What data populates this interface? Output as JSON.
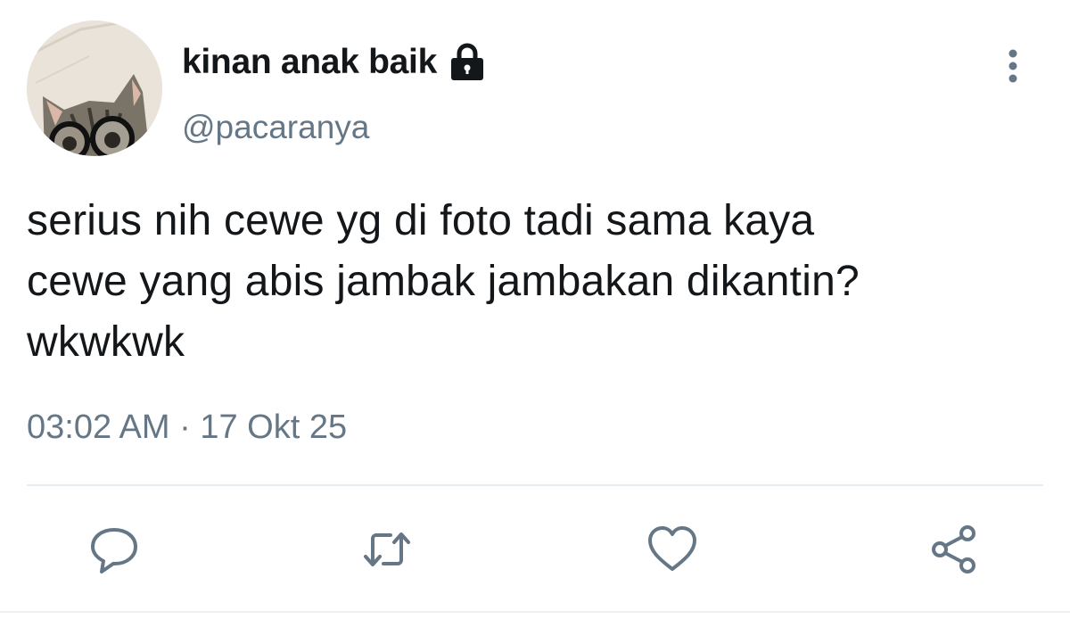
{
  "user": {
    "display_name": "kinan anak baik",
    "handle": "@pacaranya",
    "avatar": "cat-with-glasses-avatar",
    "protected_icon": "lock-icon"
  },
  "tweet": {
    "text": "serius nih cewe yg di foto tadi sama kaya\ncewe yang abis jambak jambakan dikantin?\nwkwkwk",
    "timestamp": "03:02 AM · 17 Okt 25"
  },
  "actions": [
    {
      "name": "reply",
      "icon": "comment-icon"
    },
    {
      "name": "retweet",
      "icon": "retweet-icon"
    },
    {
      "name": "like",
      "icon": "heart-icon"
    },
    {
      "name": "share",
      "icon": "share-icon"
    }
  ],
  "colors": {
    "text_primary": "#14171a",
    "text_secondary": "#657786",
    "icon": "#657786",
    "divider": "#e6ecf0"
  }
}
